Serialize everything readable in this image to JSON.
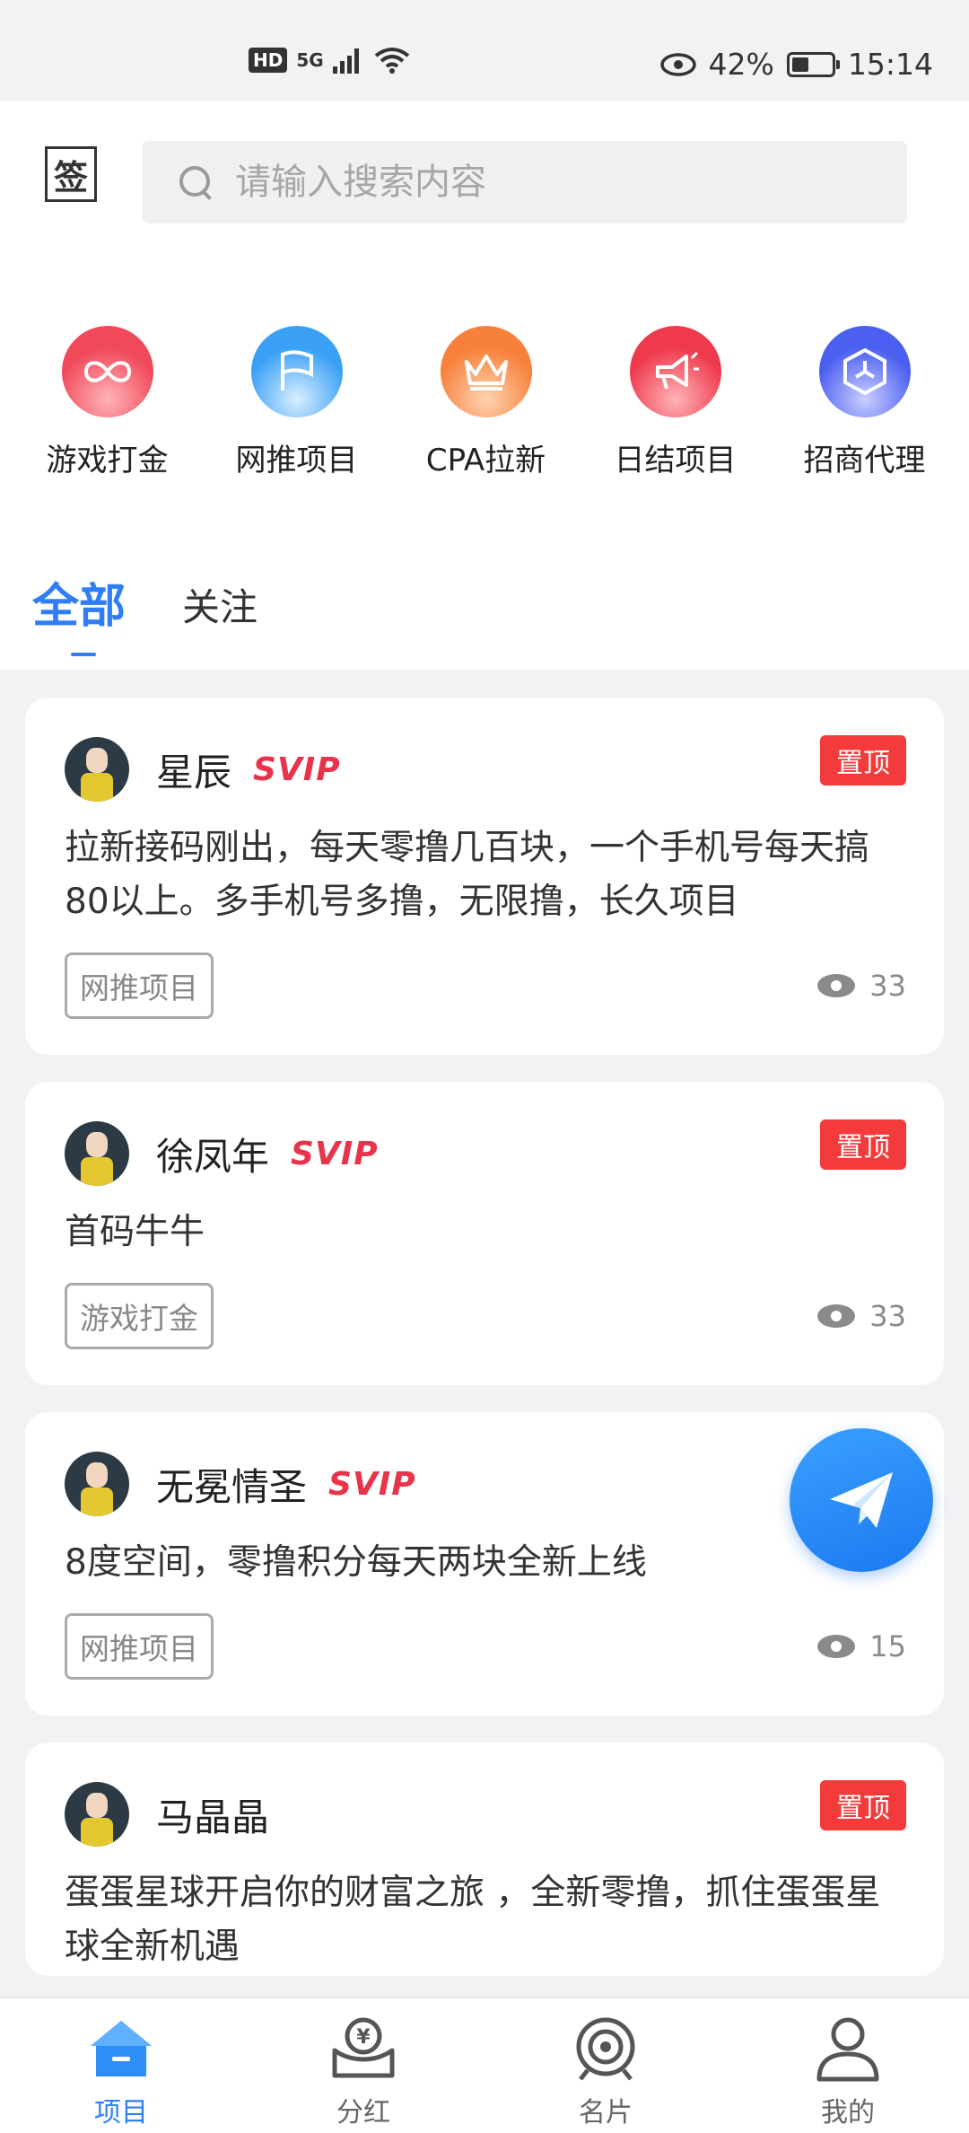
{
  "status_bar": {
    "network": "5G",
    "hd": "HD",
    "battery_percent": "42%",
    "time": "15:14",
    "battery_level": 0.42
  },
  "header": {
    "sign_label": "签",
    "search_placeholder": "请输入搜索内容"
  },
  "categories": [
    {
      "label": "游戏打金",
      "icon": "infinity-icon",
      "color": "#f0495a"
    },
    {
      "label": "网推项目",
      "icon": "flag-icon",
      "color": "#3aa0f5"
    },
    {
      "label": "CPA拉新",
      "icon": "crown-icon",
      "color": "#f7813c"
    },
    {
      "label": "日结项目",
      "icon": "megaphone-icon",
      "color": "#ee3a4c"
    },
    {
      "label": "招商代理",
      "icon": "hexagon-icon",
      "color": "#4b5ff0"
    }
  ],
  "tabs": {
    "all": "全部",
    "follow": "关注"
  },
  "posts": [
    {
      "author": "星辰",
      "vip": "SVIP",
      "pinned": "置顶",
      "text": "拉新接码刚出，每天零撸几百块，一个手机号每天搞80以上。多手机号多撸，无限撸，长久项目",
      "tag": "网推项目",
      "views": "33"
    },
    {
      "author": "徐凤年",
      "vip": "SVIP",
      "pinned": "置顶",
      "text": "首码牛牛",
      "tag": "游戏打金",
      "views": "33"
    },
    {
      "author": "无冕情圣",
      "vip": "SVIP",
      "pinned": "",
      "text": "8度空间，零撸积分每天两块全新上线",
      "tag": "网推项目",
      "views": "15"
    },
    {
      "author": "马晶晶",
      "vip": "",
      "pinned": "置顶",
      "text": "蛋蛋星球开启你的财富之旅 ，全新零撸，抓住蛋蛋星球全新机遇",
      "tag": "",
      "views": ""
    }
  ],
  "bottom_nav": [
    {
      "label": "项目",
      "icon": "home-icon",
      "active": true
    },
    {
      "label": "分红",
      "icon": "dividend-icon",
      "active": false
    },
    {
      "label": "名片",
      "icon": "card-icon",
      "active": false
    },
    {
      "label": "我的",
      "icon": "profile-icon",
      "active": false
    }
  ],
  "colors": {
    "accent": "#2f7ef5",
    "pin": "#f33b3b",
    "svip": "#e8344a"
  }
}
